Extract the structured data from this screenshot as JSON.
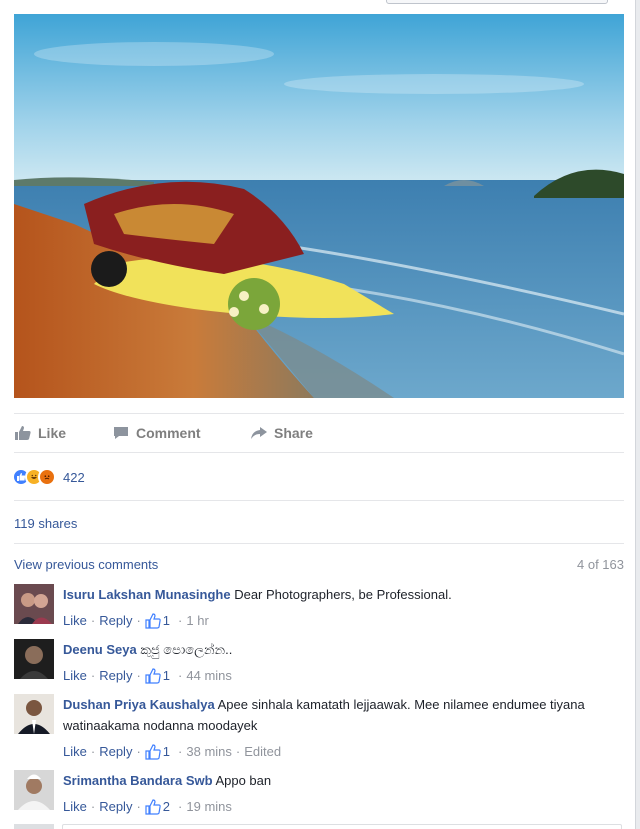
{
  "actions": {
    "like": "Like",
    "comment": "Comment",
    "share": "Share"
  },
  "reactions": {
    "count": "422",
    "types": [
      "like-icon",
      "haha-icon",
      "angry-icon"
    ],
    "colors": {
      "like": "#4080ff",
      "haha": "#f7b125",
      "angry": "#e9710f"
    }
  },
  "shares": "119 shares",
  "previous": {
    "link": "View previous comments",
    "count": "4 of 163"
  },
  "comments": [
    {
      "name": "Isuru Lakshan Munasinghe",
      "text": " Dear Photographers, be Professional.",
      "like": "Like",
      "reply": "Reply",
      "likes": "1",
      "time": "1 hr",
      "edited": ""
    },
    {
      "name": "Deenu Seya",
      "text": " කුජු පොලෙන්න..",
      "like": "Like",
      "reply": "Reply",
      "likes": "1",
      "time": "44 mins",
      "edited": ""
    },
    {
      "name": "Dushan Priya Kaushalya",
      "text": " Apee sinhala kamatath lejjaawak. Mee nilamee endumee tiyana watinaakama nodanna moodayek",
      "like": "Like",
      "reply": "Reply",
      "likes": "1",
      "time": "38 mins",
      "edited": "Edited"
    },
    {
      "name": "Srimantha Bandara Swb",
      "text": " Appo ban",
      "like": "Like",
      "reply": "Reply",
      "likes": "2",
      "time": "19 mins",
      "edited": ""
    }
  ],
  "colors": {
    "link": "#365899",
    "muted": "#90949c",
    "action": "#7f7f7f"
  }
}
